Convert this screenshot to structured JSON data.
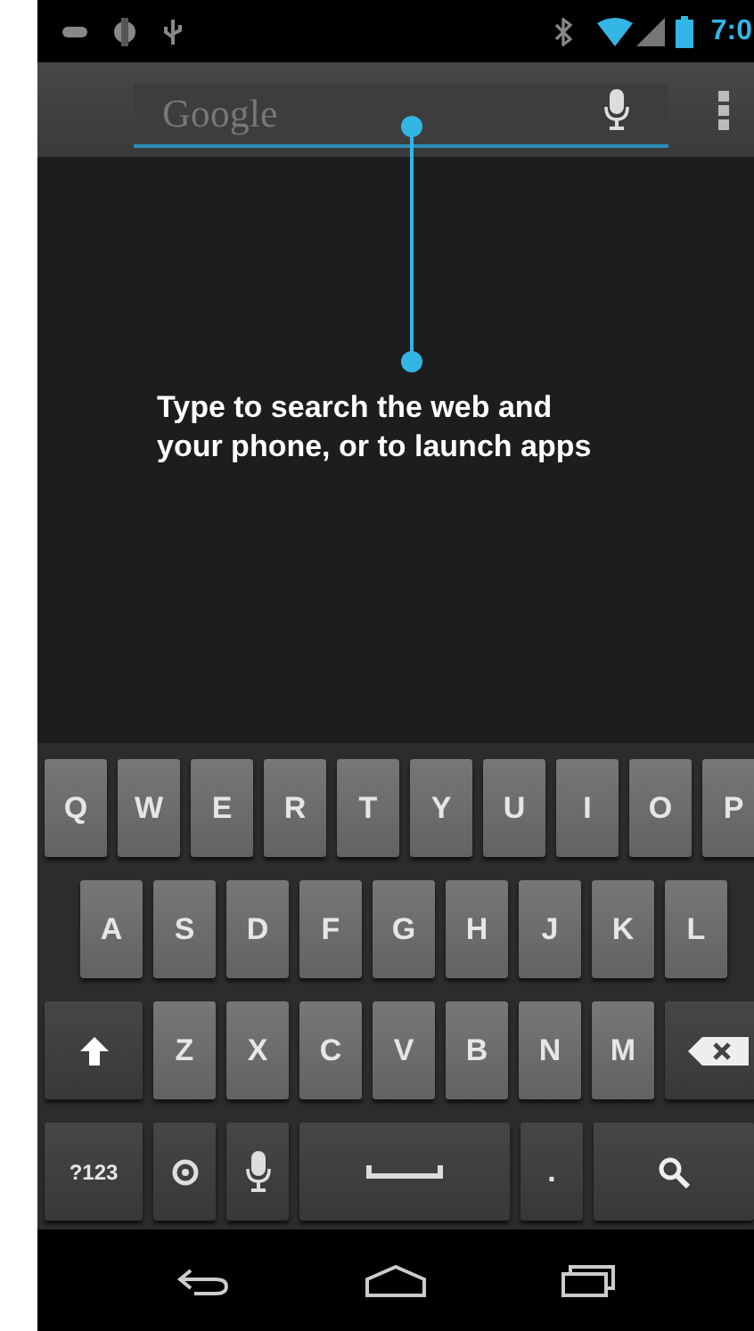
{
  "status_bar": {
    "time": "7:0"
  },
  "search": {
    "placeholder": "Google"
  },
  "hint": "Type to search the web and your phone, or to launch apps",
  "keyboard": {
    "rows": [
      {
        "keys": [
          {
            "kind": "letter",
            "label": "Q"
          },
          {
            "kind": "letter",
            "label": "W"
          },
          {
            "kind": "letter",
            "label": "E"
          },
          {
            "kind": "letter",
            "label": "R"
          },
          {
            "kind": "letter",
            "label": "T"
          },
          {
            "kind": "letter",
            "label": "Y"
          },
          {
            "kind": "letter",
            "label": "U"
          },
          {
            "kind": "letter",
            "label": "I"
          },
          {
            "kind": "letter",
            "label": "O"
          },
          {
            "kind": "letter",
            "label": "P"
          }
        ]
      },
      {
        "keys": [
          {
            "kind": "letter",
            "label": "A"
          },
          {
            "kind": "letter",
            "label": "S"
          },
          {
            "kind": "letter",
            "label": "D"
          },
          {
            "kind": "letter",
            "label": "F"
          },
          {
            "kind": "letter",
            "label": "G"
          },
          {
            "kind": "letter",
            "label": "H"
          },
          {
            "kind": "letter",
            "label": "J"
          },
          {
            "kind": "letter",
            "label": "K"
          },
          {
            "kind": "letter",
            "label": "L"
          }
        ]
      },
      {
        "keys": [
          {
            "kind": "shift"
          },
          {
            "kind": "letter",
            "label": "Z"
          },
          {
            "kind": "letter",
            "label": "X"
          },
          {
            "kind": "letter",
            "label": "C"
          },
          {
            "kind": "letter",
            "label": "V"
          },
          {
            "kind": "letter",
            "label": "B"
          },
          {
            "kind": "letter",
            "label": "N"
          },
          {
            "kind": "letter",
            "label": "M"
          },
          {
            "kind": "backspace"
          }
        ]
      },
      {
        "keys": [
          {
            "kind": "symbols",
            "label": "?123"
          },
          {
            "kind": "settings"
          },
          {
            "kind": "mic"
          },
          {
            "kind": "space"
          },
          {
            "kind": "period",
            "label": "."
          },
          {
            "kind": "search"
          }
        ]
      }
    ]
  }
}
